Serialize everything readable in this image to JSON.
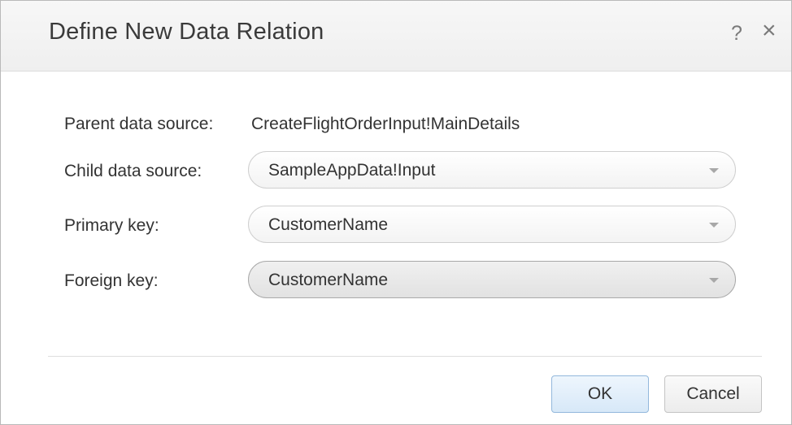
{
  "dialog": {
    "title": "Define New Data Relation",
    "help_icon": "help-icon",
    "help_glyph": "?",
    "close_icon": "close-icon",
    "close_glyph": "×"
  },
  "form": {
    "parent_source": {
      "label": "Parent data source:",
      "value": "CreateFlightOrderInput!MainDetails"
    },
    "child_source": {
      "label": "Child data source:",
      "value": "SampleAppData!Input"
    },
    "primary_key": {
      "label": "Primary key:",
      "value": "CustomerName"
    },
    "foreign_key": {
      "label": "Foreign key:",
      "value": "CustomerName"
    }
  },
  "buttons": {
    "ok_label": "OK",
    "cancel_label": "Cancel"
  },
  "colors": {
    "ok_border": "#93b8dc",
    "title_text": "#3a3a3a"
  }
}
